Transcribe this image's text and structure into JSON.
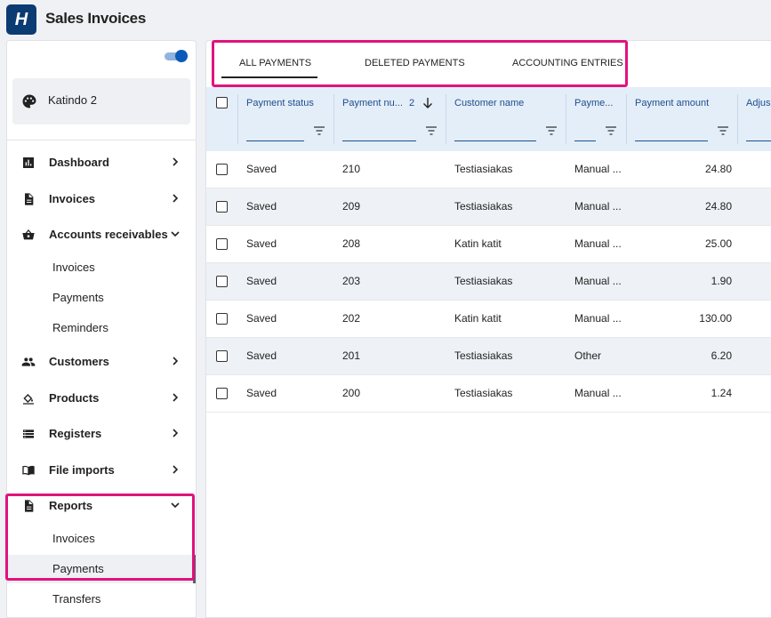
{
  "app": {
    "logo_letter": "H",
    "title": "Sales Invoices"
  },
  "sidebar": {
    "org_name": "Katindo 2",
    "items": [
      {
        "label": "Dashboard"
      },
      {
        "label": "Invoices"
      },
      {
        "label": "Accounts receivables",
        "sub": [
          "Invoices",
          "Payments",
          "Reminders"
        ]
      },
      {
        "label": "Customers"
      },
      {
        "label": "Products"
      },
      {
        "label": "Registers"
      },
      {
        "label": "File imports"
      },
      {
        "label": "Reports",
        "sub": [
          "Invoices",
          "Payments",
          "Transfers"
        ]
      }
    ]
  },
  "tabs": [
    "ALL PAYMENTS",
    "DELETED PAYMENTS",
    "ACCOUNTING ENTRIES"
  ],
  "table": {
    "columns": [
      "Payment status",
      "Payment nu...",
      "Customer name",
      "Payme...",
      "Payment amount",
      "Adjus"
    ],
    "sort_index": "2",
    "rows": [
      {
        "status": "Saved",
        "number": "210",
        "customer": "Testiasiakas",
        "type": "Manual ...",
        "amount": "24.80"
      },
      {
        "status": "Saved",
        "number": "209",
        "customer": "Testiasiakas",
        "type": "Manual ...",
        "amount": "24.80"
      },
      {
        "status": "Saved",
        "number": "208",
        "customer": "Katin katit",
        "type": "Manual ...",
        "amount": "25.00"
      },
      {
        "status": "Saved",
        "number": "203",
        "customer": "Testiasiakas",
        "type": "Manual ...",
        "amount": "1.90"
      },
      {
        "status": "Saved",
        "number": "202",
        "customer": "Katin katit",
        "type": "Manual ...",
        "amount": "130.00"
      },
      {
        "status": "Saved",
        "number": "201",
        "customer": "Testiasiakas",
        "type": "Other",
        "amount": "6.20"
      },
      {
        "status": "Saved",
        "number": "200",
        "customer": "Testiasiakas",
        "type": "Manual ...",
        "amount": "1.24"
      }
    ]
  },
  "colors": {
    "brand": "#0b3b73",
    "highlight": "#e0137d",
    "header_bg": "#e4eef9",
    "header_text": "#1f4d8c"
  }
}
